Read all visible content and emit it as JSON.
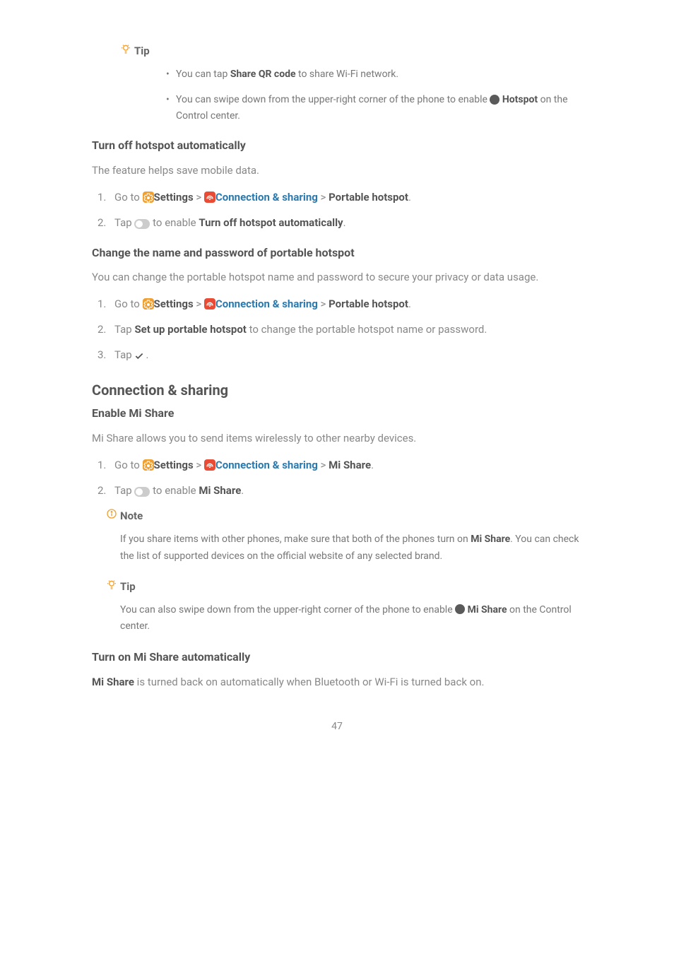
{
  "tip1": {
    "label": "Tip",
    "bullet1_pre": "You can tap ",
    "bullet1_bold": "Share QR code",
    "bullet1_post": " to share Wi-Fi network.",
    "bullet2_pre": "You can swipe down from the upper-right corner of the phone to enable ",
    "bullet2_bold": "Hotspot",
    "bullet2_post": " on the Control center."
  },
  "sec1": {
    "heading": "Turn off hotspot automatically",
    "desc": "The feature helps save mobile data.",
    "step1_n": "1.",
    "step1_pre": "Go to ",
    "step1_settings": "Settings",
    "step1_sep": " > ",
    "step1_conn": "Connection & sharing",
    "step1_sep2": " > ",
    "step1_port": "Portable hotspot",
    "step1_post": ".",
    "step2_n": "2.",
    "step2_pre": "Tap ",
    "step2_mid": " to enable ",
    "step2_bold": "Turn off hotspot automatically",
    "step2_post": "."
  },
  "sec2": {
    "heading": "Change the name and password of portable hotspot",
    "desc": "You can change the portable hotspot name and password to secure your privacy or data usage.",
    "step1_n": "1.",
    "step1_pre": "Go to ",
    "step1_settings": "Settings",
    "step1_sep": " > ",
    "step1_conn": "Connection & sharing",
    "step1_sep2": " > ",
    "step1_port": "Portable hotspot",
    "step1_post": ".",
    "step2_n": "2.",
    "step2_pre": "Tap ",
    "step2_bold": "Set up portable hotspot",
    "step2_post": " to change the portable hotspot name or password.",
    "step3_n": "3.",
    "step3_pre": "Tap ",
    "step3_post": "."
  },
  "sec3": {
    "heading_main": "Connection & sharing",
    "heading": "Enable Mi Share",
    "desc": "Mi Share allows you to send items wirelessly to other nearby devices.",
    "step1_n": "1.",
    "step1_pre": "Go to ",
    "step1_settings": "Settings",
    "step1_sep": " > ",
    "step1_conn": "Connection & sharing",
    "step1_sep2": " > ",
    "step1_mishare": "Mi Share",
    "step1_post": ".",
    "step2_n": "2.",
    "step2_pre": "Tap ",
    "step2_mid": " to enable ",
    "step2_bold": "Mi Share",
    "step2_post": "."
  },
  "note1": {
    "label": "Note",
    "body_pre": "If you share items with other phones, make sure that both of the phones turn on ",
    "body_bold": "Mi Share",
    "body_post": ". You can check the list of supported devices on the official website of any selected brand."
  },
  "tip2": {
    "label": "Tip",
    "body_pre": "You can also swipe down from the upper-right corner of the phone to enable ",
    "body_bold": "Mi Share",
    "body_post": " on the Control center."
  },
  "sec4": {
    "heading": "Turn on Mi Share automatically",
    "desc_bold": "Mi Share",
    "desc_post": " is turned back on automatically when Bluetooth or Wi-Fi is turned back on."
  },
  "page_num": "47"
}
